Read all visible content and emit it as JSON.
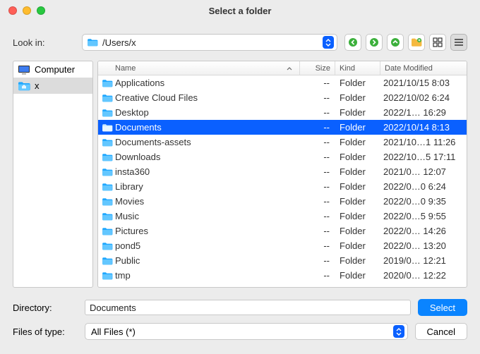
{
  "window": {
    "title": "Select a folder"
  },
  "lookin": {
    "label": "Look in:",
    "path": "/Users/x"
  },
  "sidebar": {
    "items": [
      {
        "label": "Computer",
        "icon": "monitor",
        "selected": false
      },
      {
        "label": "x",
        "icon": "home-folder",
        "selected": true
      }
    ]
  },
  "columns": {
    "name": "Name",
    "size": "Size",
    "kind": "Kind",
    "date": "Date Modified"
  },
  "rows": [
    {
      "name": "Applications",
      "size": "--",
      "kind": "Folder",
      "date": "2021/10/15 8:03",
      "selected": false
    },
    {
      "name": "Creative Cloud Files",
      "size": "--",
      "kind": "Folder",
      "date": "2022/10/02 6:24",
      "selected": false
    },
    {
      "name": "Desktop",
      "size": "--",
      "kind": "Folder",
      "date": "2022/1… 16:29",
      "selected": false
    },
    {
      "name": "Documents",
      "size": "--",
      "kind": "Folder",
      "date": "2022/10/14 8:13",
      "selected": true
    },
    {
      "name": "Documents-assets",
      "size": "--",
      "kind": "Folder",
      "date": "2021/10…1 11:26",
      "selected": false
    },
    {
      "name": "Downloads",
      "size": "--",
      "kind": "Folder",
      "date": "2022/10…5 17:11",
      "selected": false
    },
    {
      "name": "insta360",
      "size": "--",
      "kind": "Folder",
      "date": "2021/0… 12:07",
      "selected": false
    },
    {
      "name": "Library",
      "size": "--",
      "kind": "Folder",
      "date": "2022/0…0 6:24",
      "selected": false
    },
    {
      "name": "Movies",
      "size": "--",
      "kind": "Folder",
      "date": "2022/0…0 9:35",
      "selected": false
    },
    {
      "name": "Music",
      "size": "--",
      "kind": "Folder",
      "date": "2022/0…5 9:55",
      "selected": false
    },
    {
      "name": "Pictures",
      "size": "--",
      "kind": "Folder",
      "date": "2022/0… 14:26",
      "selected": false
    },
    {
      "name": "pond5",
      "size": "--",
      "kind": "Folder",
      "date": "2022/0… 13:20",
      "selected": false
    },
    {
      "name": "Public",
      "size": "--",
      "kind": "Folder",
      "date": "2019/0… 12:21",
      "selected": false
    },
    {
      "name": "tmp",
      "size": "--",
      "kind": "Folder",
      "date": "2020/0… 12:22",
      "selected": false
    }
  ],
  "directory": {
    "label": "Directory:",
    "value": "Documents"
  },
  "filter": {
    "label": "Files of type:",
    "value": "All Files (*)"
  },
  "buttons": {
    "select": "Select",
    "cancel": "Cancel"
  }
}
